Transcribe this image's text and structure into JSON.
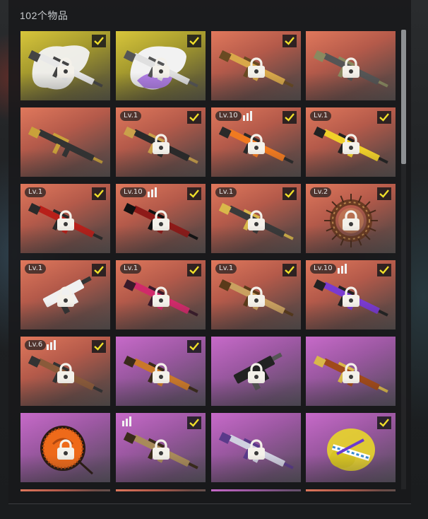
{
  "header": {
    "item_count": "102个物品"
  },
  "colors": {
    "orange": "#d8735a",
    "purple": "#b665b9",
    "yellow": "#c9b93a",
    "check": "#f0df2a"
  },
  "items": [
    {
      "rarity": "yellow",
      "level": "",
      "upgrades": 0,
      "equipped": true,
      "locked": true,
      "icon": "rifle-splash-white-icon"
    },
    {
      "rarity": "yellow",
      "level": "",
      "upgrades": 0,
      "equipped": true,
      "locked": true,
      "icon": "rifle-splash-purple-icon"
    },
    {
      "rarity": "orange",
      "level": "",
      "upgrades": 0,
      "equipped": true,
      "locked": true,
      "icon": "rifle-gold-icon"
    },
    {
      "rarity": "orange",
      "level": "",
      "upgrades": 0,
      "equipped": false,
      "locked": true,
      "icon": "rifle-camo-icon"
    },
    {
      "rarity": "orange",
      "level": "",
      "upgrades": 0,
      "equipped": false,
      "locked": false,
      "icon": "rifle-gold-dark-icon"
    },
    {
      "rarity": "orange",
      "level": "Lv.1",
      "upgrades": 0,
      "equipped": true,
      "locked": true,
      "icon": "rifle-dark-icon"
    },
    {
      "rarity": "orange",
      "level": "Lv.10",
      "upgrades": 3,
      "equipped": true,
      "locked": true,
      "icon": "rifle-orange-icon"
    },
    {
      "rarity": "orange",
      "level": "Lv.1",
      "upgrades": 0,
      "equipped": true,
      "locked": true,
      "icon": "rifle-yellow-icon"
    },
    {
      "rarity": "orange",
      "level": "Lv.1",
      "upgrades": 0,
      "equipped": true,
      "locked": true,
      "icon": "rifle-red-icon"
    },
    {
      "rarity": "orange",
      "level": "Lv.10",
      "upgrades": 3,
      "equipped": true,
      "locked": true,
      "icon": "rifle-crimson-icon"
    },
    {
      "rarity": "orange",
      "level": "Lv.1",
      "upgrades": 0,
      "equipped": true,
      "locked": true,
      "icon": "rifle-sniper-icon"
    },
    {
      "rarity": "orange",
      "level": "Lv.2",
      "upgrades": 0,
      "equipped": true,
      "locked": true,
      "icon": "spiked-frame-icon"
    },
    {
      "rarity": "orange",
      "level": "Lv.1",
      "upgrades": 0,
      "equipped": true,
      "locked": true,
      "icon": "smg-white-icon"
    },
    {
      "rarity": "orange",
      "level": "Lv.1",
      "upgrades": 0,
      "equipped": true,
      "locked": true,
      "icon": "rifle-pink-icon"
    },
    {
      "rarity": "orange",
      "level": "Lv.1",
      "upgrades": 0,
      "equipped": true,
      "locked": true,
      "icon": "rifle-brass-icon"
    },
    {
      "rarity": "orange",
      "level": "Lv.10",
      "upgrades": 3,
      "equipped": true,
      "locked": true,
      "icon": "rifle-violet-icon"
    },
    {
      "rarity": "orange",
      "level": "Lv.6",
      "upgrades": 3,
      "equipped": true,
      "locked": true,
      "icon": "rifle-wood-icon"
    },
    {
      "rarity": "purple",
      "level": "",
      "upgrades": 0,
      "equipped": true,
      "locked": true,
      "icon": "rifle-orange-wood-icon"
    },
    {
      "rarity": "purple",
      "level": "",
      "upgrades": 0,
      "equipped": false,
      "locked": true,
      "icon": "smg-black-icon"
    },
    {
      "rarity": "purple",
      "level": "",
      "upgrades": 0,
      "equipped": false,
      "locked": true,
      "icon": "rifle-gold-wood-icon"
    },
    {
      "rarity": "purple",
      "level": "",
      "upgrades": 0,
      "equipped": false,
      "locked": true,
      "icon": "orange-disc-icon"
    },
    {
      "rarity": "purple",
      "level": "",
      "upgrades": 3,
      "equipped": true,
      "locked": true,
      "icon": "rifle-camo-tan-icon"
    },
    {
      "rarity": "purple",
      "level": "",
      "upgrades": 0,
      "equipped": false,
      "locked": true,
      "icon": "rifle-silver-icon"
    },
    {
      "rarity": "purple",
      "level": "",
      "upgrades": 0,
      "equipped": true,
      "locked": false,
      "icon": "yellow-splash-icon"
    }
  ],
  "partial_row": [
    "orange",
    "orange",
    "purple",
    "orange"
  ]
}
